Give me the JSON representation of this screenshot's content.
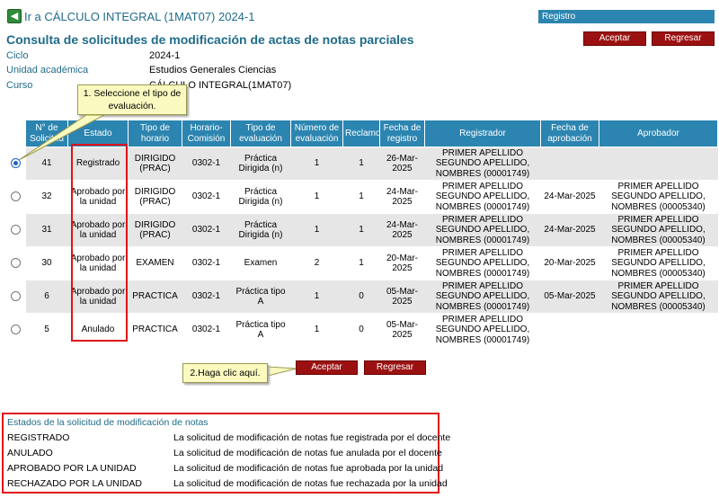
{
  "header": {
    "back_label": "Ir a CÁLCULO INTEGRAL (1MAT07) 2024-1",
    "panel_title": "Registro",
    "page_title": "Consulta de solicitudes de modificación de actas de notas parciales",
    "accept_label": "Aceptar",
    "return_label": "Regresar"
  },
  "info": [
    {
      "label": "Ciclo",
      "value": "2024-1"
    },
    {
      "label": "Unidad académica",
      "value": "Estudios Generales Ciencias"
    },
    {
      "label": "Curso",
      "value": "CÁLCULO INTEGRAL(1MAT07)"
    }
  ],
  "table": {
    "headers": [
      "N° de Solicitud",
      "Estado",
      "Tipo de horario",
      "Horario-Comisión",
      "Tipo de evaluación",
      "Número de evaluación",
      "Reclamo",
      "Fecha de registro",
      "Registrador",
      "Fecha de aprobación",
      "Aprobador"
    ],
    "rows": [
      [
        "41",
        "Registrado",
        "DIRIGIDO (PRAC)",
        "0302-1",
        "Práctica Dirigida (n)",
        "1",
        "1",
        "26-Mar-2025",
        "PRIMER APELLIDO SEGUNDO APELLIDO, NOMBRES (00001749)",
        "",
        ""
      ],
      [
        "32",
        "Aprobado por la unidad",
        "DIRIGIDO (PRAC)",
        "0302-1",
        "Práctica Dirigida (n)",
        "1",
        "1",
        "24-Mar-2025",
        "PRIMER APELLIDO SEGUNDO APELLIDO, NOMBRES (00001749)",
        "24-Mar-2025",
        "PRIMER APELLIDO SEGUNDO APELLIDO, NOMBRES (00005340)"
      ],
      [
        "31",
        "Aprobado por la unidad",
        "DIRIGIDO (PRAC)",
        "0302-1",
        "Práctica Dirigida (n)",
        "1",
        "1",
        "24-Mar-2025",
        "PRIMER APELLIDO SEGUNDO APELLIDO, NOMBRES (00001749)",
        "24-Mar-2025",
        "PRIMER APELLIDO SEGUNDO APELLIDO, NOMBRES (00005340)"
      ],
      [
        "30",
        "Aprobado por la unidad",
        "EXAMEN",
        "0302-1",
        "Examen",
        "2",
        "1",
        "20-Mar-2025",
        "PRIMER APELLIDO SEGUNDO APELLIDO, NOMBRES (00001749)",
        "20-Mar-2025",
        "PRIMER APELLIDO SEGUNDO APELLIDO, NOMBRES (00005340)"
      ],
      [
        "6",
        "Aprobado por la unidad",
        "PRACTICA",
        "0302-1",
        "Práctica tipo A",
        "1",
        "0",
        "05-Mar-2025",
        "PRIMER APELLIDO SEGUNDO APELLIDO, NOMBRES (00001749)",
        "05-Mar-2025",
        "PRIMER APELLIDO SEGUNDO APELLIDO, NOMBRES (00005340)"
      ],
      [
        "5",
        "Anulado",
        "PRACTICA",
        "0302-1",
        "Práctica tipo A",
        "1",
        "0",
        "05-Mar-2025",
        "PRIMER APELLIDO SEGUNDO APELLIDO, NOMBRES (00001749)",
        "",
        ""
      ]
    ],
    "selected_index": 0
  },
  "callouts": {
    "step1": "1. Seleccione el tipo de evaluación.",
    "step2": "2.Haga clic aquí."
  },
  "legend": {
    "title": "Estados de la solicitud de modificación de notas",
    "items": [
      {
        "state": "REGISTRADO",
        "desc": "La solicitud de modificación de notas fue registrada por el docente"
      },
      {
        "state": "ANULADO",
        "desc": "La solicitud de modificación de notas fue anulada por el docente"
      },
      {
        "state": "APROBADO POR LA UNIDAD",
        "desc": "La solicitud de modificación de notas fue aprobada por la unidad"
      },
      {
        "state": "RECHAZADO POR LA UNIDAD",
        "desc": "La solicitud de modificación de notas fue rechazada por la unidad"
      }
    ]
  },
  "colors": {
    "header_blue": "#2c85b0",
    "title_teal": "#1f6b8a",
    "button_red": "#9b1111",
    "highlight_red": "#e0121a",
    "callout_yellow": "#fafac0"
  },
  "icons": {
    "back": "green-arrow-left-icon"
  }
}
